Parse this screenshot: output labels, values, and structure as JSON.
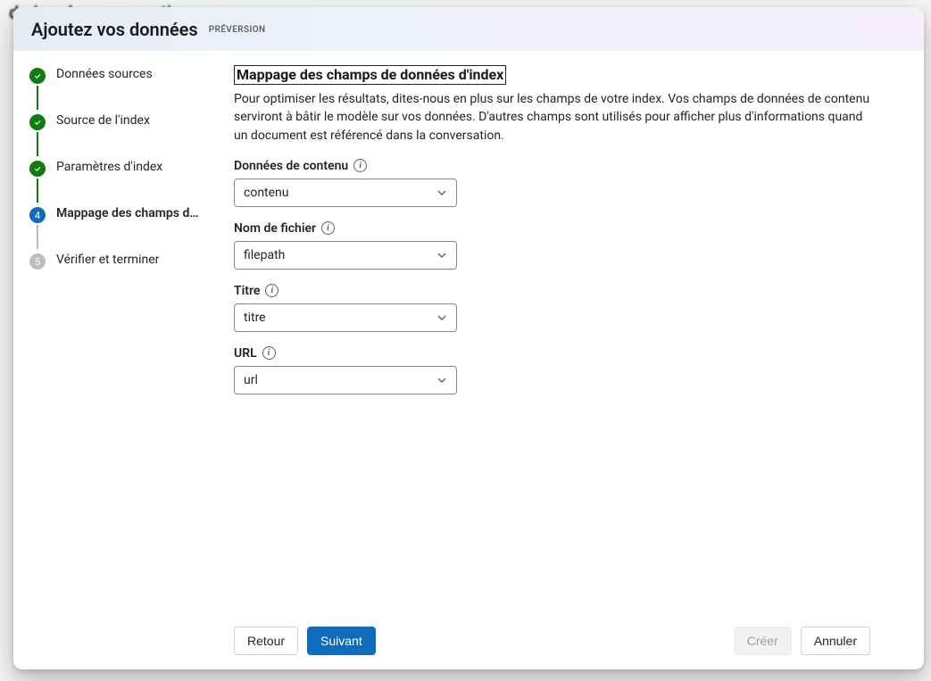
{
  "background_heading": "do jou do convorcation",
  "dialog": {
    "title": "Ajoutez vos données",
    "badge": "PRÉVERSION"
  },
  "steps": [
    {
      "label": "Données sources",
      "state": "done"
    },
    {
      "label": "Source de l'index",
      "state": "done"
    },
    {
      "label": "Paramètres d'index",
      "state": "done"
    },
    {
      "label": "Mappage des champs d…",
      "state": "current"
    },
    {
      "label": "Vérifier et terminer",
      "state": "future",
      "num": "5"
    }
  ],
  "section": {
    "title": "Mappage des champs de données d'index",
    "description": "Pour optimiser les résultats, dites-nous en plus sur les champs de votre index. Vos champs de données de contenu serviront à bâtir le modèle sur vos données. D'autres champs sont utilisés pour afficher plus d'informations quand un document est référencé dans la conversation."
  },
  "fields": [
    {
      "label": "Données de contenu",
      "value": "contenu"
    },
    {
      "label": "Nom de fichier",
      "value": "filepath"
    },
    {
      "label": "Titre",
      "value": "titre"
    },
    {
      "label": "URL",
      "value": "url"
    }
  ],
  "buttons": {
    "back": "Retour",
    "next": "Suivant",
    "create": "Créer",
    "cancel": "Annuler"
  }
}
